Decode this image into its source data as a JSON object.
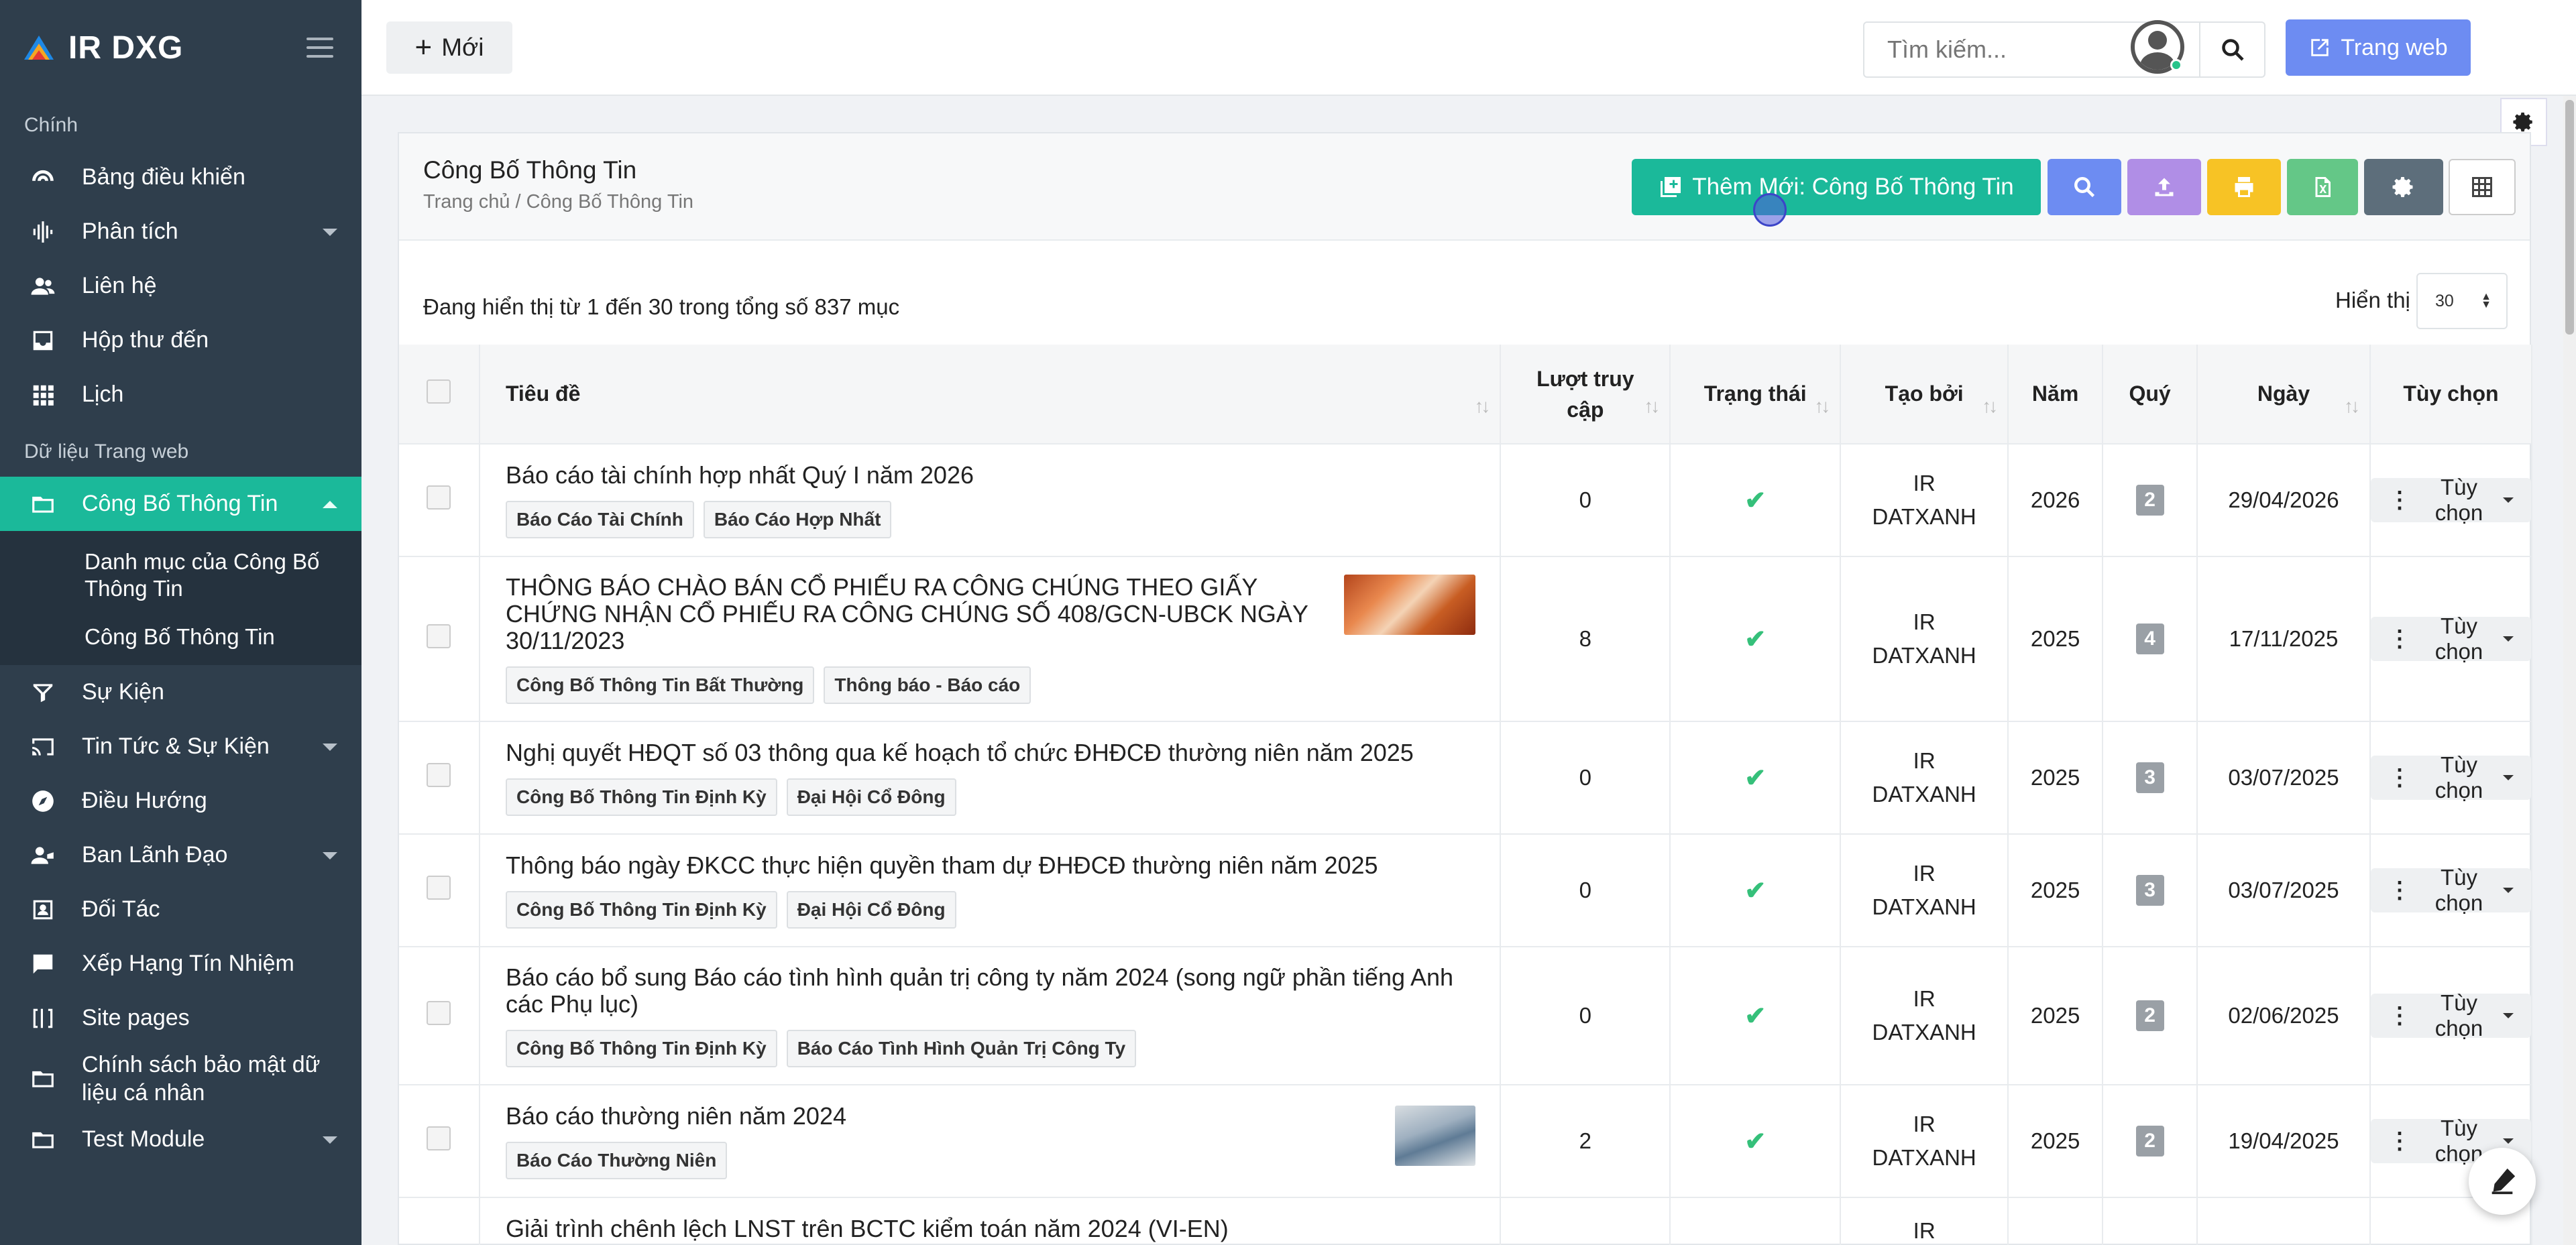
{
  "brand": {
    "name": "IR DXG"
  },
  "sidebar": {
    "section_main": "Chính",
    "items_main": [
      {
        "label": "Bảng điều khiển",
        "icon": "dashboard-icon"
      },
      {
        "label": "Phân tích",
        "icon": "analytics-icon",
        "has_caret": true
      },
      {
        "label": "Liên hệ",
        "icon": "contacts-icon"
      },
      {
        "label": "Hộp thư đến",
        "icon": "inbox-icon"
      },
      {
        "label": "Lịch",
        "icon": "calendar-icon"
      }
    ],
    "section_web": "Dữ liệu Trang web",
    "active_item": {
      "label": "Công Bố Thông Tin",
      "icon": "folder-icon"
    },
    "sub_items": [
      {
        "label": "Danh mục của Công Bố Thông Tin"
      },
      {
        "label": "Công Bố Thông Tin"
      }
    ],
    "items_web": [
      {
        "label": "Sự Kiện",
        "icon": "filter-icon"
      },
      {
        "label": "Tin Tức & Sự Kiện",
        "icon": "news-icon",
        "has_caret": true
      },
      {
        "label": "Điều Hướng",
        "icon": "compass-icon"
      },
      {
        "label": "Ban Lãnh Đạo",
        "icon": "team-icon",
        "has_caret": true
      },
      {
        "label": "Đối Tác",
        "icon": "partner-icon"
      },
      {
        "label": "Xếp Hạng Tín Nhiệm",
        "icon": "rating-icon"
      },
      {
        "label": "Site pages",
        "icon": "pages-icon"
      },
      {
        "label": "Chính sách bảo mật dữ liệu cá nhân",
        "icon": "folder-icon"
      },
      {
        "label": "Test Module",
        "icon": "folder-icon",
        "has_caret": true
      }
    ]
  },
  "topbar": {
    "new_label": "Mới",
    "search_placeholder": "Tìm kiếm...",
    "website_label": "Trang web"
  },
  "page": {
    "title": "Công Bố Thông Tin",
    "breadcrumb": "Trang chủ / Công Bố Thông Tin",
    "add_button": "Thêm Mới: Công Bố Thông Tin",
    "summary": "Đang hiển thị từ 1 đến 30 trong tổng số 837 mục",
    "show_label": "Hiển thị",
    "page_size": "30"
  },
  "table": {
    "headers": {
      "title": "Tiêu đề",
      "views": "Lượt truy cập",
      "status": "Trạng thái",
      "created_by": "Tạo bởi",
      "year": "Năm",
      "quarter": "Quý",
      "date": "Ngày",
      "options": "Tùy chọn"
    },
    "rows": [
      {
        "title": "Báo cáo tài chính hợp nhất Quý I năm 2026",
        "tags": [
          "Báo Cáo Tài Chính",
          "Báo Cáo Hợp Nhất"
        ],
        "views": "0",
        "by1": "IR",
        "by2": "DATXANH",
        "year": "2026",
        "quarter": "2",
        "date": "29/04/2026",
        "opt": "Tùy chọn",
        "image": ""
      },
      {
        "title": "THÔNG BÁO CHÀO BÁN CỔ PHIẾU RA CÔNG CHÚNG THEO GIẤY CHỨNG NHẬN CỔ PHIẾU RA CÔNG CHÚNG SỐ 408/GCN-UBCK NGÀY 30/11/2023",
        "tags": [
          "Công Bố Thông Tin Bất Thường",
          "Thông báo - Báo cáo"
        ],
        "views": "8",
        "by1": "IR",
        "by2": "DATXANH",
        "year": "2025",
        "quarter": "4",
        "date": "17/11/2025",
        "opt": "Tùy chọn",
        "image": "photo-thumbnail"
      },
      {
        "title": "Nghị quyết HĐQT số 03 thông qua kế hoạch tổ chức ĐHĐCĐ thường niên năm 2025",
        "tags": [
          "Công Bố Thông Tin Định Kỳ",
          "Đại Hội Cổ Đông"
        ],
        "views": "0",
        "by1": "IR",
        "by2": "DATXANH",
        "year": "2025",
        "quarter": "3",
        "date": "03/07/2025",
        "opt": "Tùy chọn",
        "image": ""
      },
      {
        "title": "Thông báo ngày ĐKCC thực hiện quyền tham dự ĐHĐCĐ thường niên năm 2025",
        "tags": [
          "Công Bố Thông Tin Định Kỳ",
          "Đại Hội Cổ Đông"
        ],
        "views": "0",
        "by1": "IR",
        "by2": "DATXANH",
        "year": "2025",
        "quarter": "3",
        "date": "03/07/2025",
        "opt": "Tùy chọn",
        "image": ""
      },
      {
        "title": "Báo cáo bổ sung Báo cáo tình hình quản trị công ty năm 2024 (song ngữ phần tiếng Anh các Phụ lục)",
        "tags": [
          "Công Bố Thông Tin Định Kỳ",
          "Báo Cáo Tình Hình Quản Trị Công Ty"
        ],
        "views": "0",
        "by1": "IR",
        "by2": "DATXANH",
        "year": "2025",
        "quarter": "2",
        "date": "02/06/2025",
        "opt": "Tùy chọn",
        "image": ""
      },
      {
        "title": "Báo cáo thường niên năm 2024",
        "tags": [
          "Báo Cáo Thường Niên"
        ],
        "views": "2",
        "by1": "IR",
        "by2": "DATXANH",
        "year": "2025",
        "quarter": "2",
        "date": "19/04/2025",
        "opt": "Tùy chọn",
        "image": "report-thumbnail"
      },
      {
        "title": "Giải trình chênh lệch LNST trên BCTC kiểm toán năm 2024 (VI-EN)",
        "tags": [],
        "views": "",
        "by1": "IR",
        "by2": "",
        "year": "",
        "quarter": "",
        "date": "",
        "opt": "",
        "image": ""
      }
    ]
  }
}
